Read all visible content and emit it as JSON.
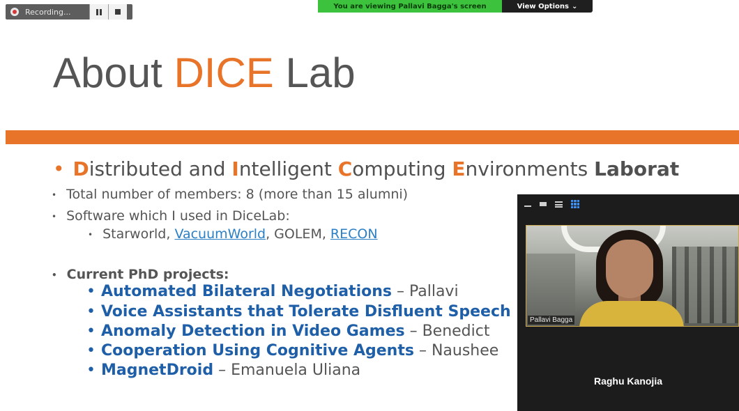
{
  "recording": {
    "label": "Recording..."
  },
  "banner": {
    "viewing": "You are viewing Pallavi Bagga's screen",
    "options": "View Options",
    "options_arrow": "⌄"
  },
  "slide": {
    "title_pre": "About ",
    "title_accent": "DICE",
    "title_post": " Lab",
    "heading_bullet": "•",
    "heading": [
      {
        "c": "D",
        "r": "istributed and "
      },
      {
        "c": "I",
        "r": "ntelligent "
      },
      {
        "c": "C",
        "r": "omputing "
      },
      {
        "c": "E",
        "r": "nvironments "
      }
    ],
    "heading_tail": "Laborat",
    "sub_bullet": "•",
    "members": "Total number of members: 8 (more than 15 alumni)",
    "software_label": "Software which I used in DiceLab:",
    "software": {
      "a": "Starworld, ",
      "link1": "VacuumWorld",
      "b": ", GOLEM, ",
      "link2": "RECON"
    },
    "phd_label": "Current PhD projects:",
    "project_bullet": "•",
    "projects": [
      {
        "title": "Automated Bilateral Negotiations",
        "rest": " – Pallavi"
      },
      {
        "title": "Voice Assistants that Tolerate Disfluent Speech",
        "rest": ""
      },
      {
        "title": "Anomaly Detection in Video Games",
        "rest": " – Benedict"
      },
      {
        "title": "Cooperation Using Cognitive Agents",
        "rest": " – Naushee"
      },
      {
        "title": "MagnetDroid",
        "rest": " – Emanuela Uliana"
      }
    ]
  },
  "video": {
    "participant_tag": "Pallavi Bagga",
    "speaker_name": "Raghu Kanojia"
  },
  "colors": {
    "accent": "#e8742a",
    "project_blue": "#1f5fa8",
    "link": "#2b7fc4"
  }
}
